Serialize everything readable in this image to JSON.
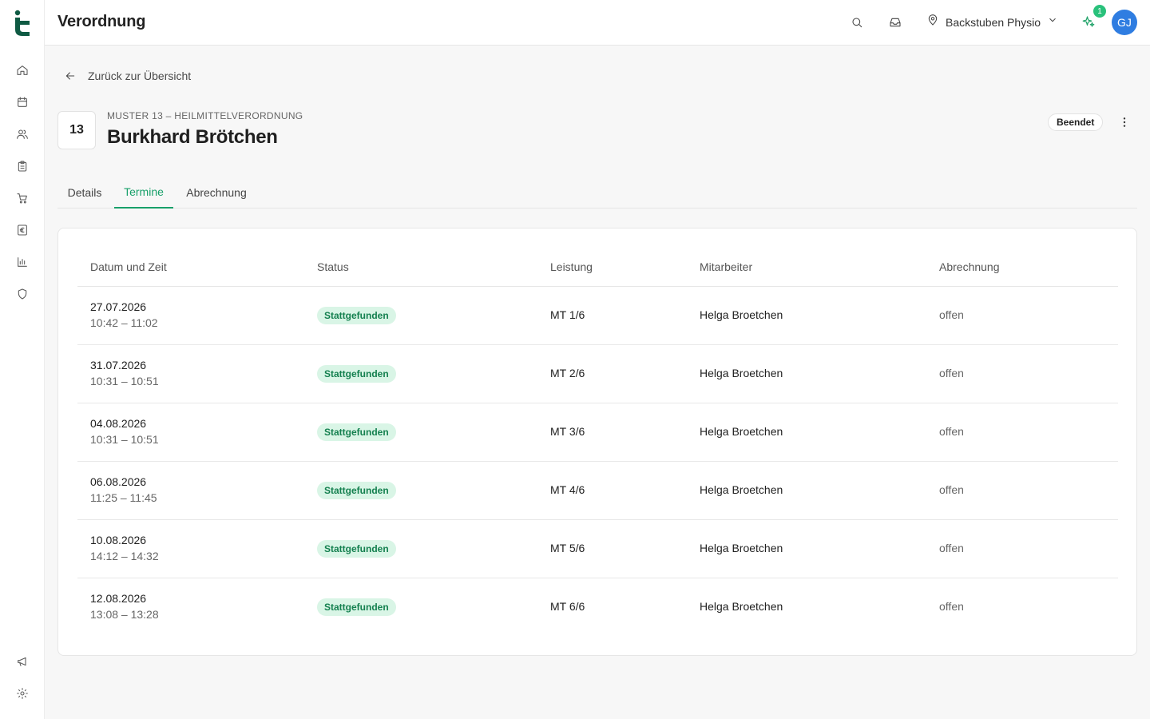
{
  "header": {
    "title": "Verordnung",
    "location": "Backstuben Physio",
    "notifications": "1",
    "avatar": "GJ"
  },
  "sidebar": {
    "items": [
      {
        "icon": "home-icon"
      },
      {
        "icon": "calendar-icon"
      },
      {
        "icon": "users-icon"
      },
      {
        "icon": "clipboard-icon"
      },
      {
        "icon": "cart-icon"
      },
      {
        "icon": "euro-icon"
      },
      {
        "icon": "chart-icon"
      },
      {
        "icon": "shield-icon"
      }
    ],
    "bottom": [
      {
        "icon": "megaphone-icon"
      },
      {
        "icon": "gear-icon"
      }
    ]
  },
  "back_link": "Zurück zur Übersicht",
  "prescription": {
    "number": "13",
    "type": "MUSTER 13 – HEILMITTELVERORDNUNG",
    "patient": "Burkhard Brötchen",
    "status": "Beendet"
  },
  "tabs": [
    {
      "label": "Details",
      "active": false
    },
    {
      "label": "Termine",
      "active": true
    },
    {
      "label": "Abrechnung",
      "active": false
    }
  ],
  "table": {
    "columns": [
      "Datum und Zeit",
      "Status",
      "Leistung",
      "Mitarbeiter",
      "Abrechnung"
    ],
    "rows": [
      {
        "date": "27.07.2026",
        "time": "10:42 – 11:02",
        "status": "Stattgefunden",
        "service": "MT 1/6",
        "staff": "Helga Broetchen",
        "billing": "offen"
      },
      {
        "date": "31.07.2026",
        "time": "10:31 – 10:51",
        "status": "Stattgefunden",
        "service": "MT 2/6",
        "staff": "Helga Broetchen",
        "billing": "offen"
      },
      {
        "date": "04.08.2026",
        "time": "10:31 – 10:51",
        "status": "Stattgefunden",
        "service": "MT 3/6",
        "staff": "Helga Broetchen",
        "billing": "offen"
      },
      {
        "date": "06.08.2026",
        "time": "11:25 – 11:45",
        "status": "Stattgefunden",
        "service": "MT 4/6",
        "staff": "Helga Broetchen",
        "billing": "offen"
      },
      {
        "date": "10.08.2026",
        "time": "14:12 – 14:32",
        "status": "Stattgefunden",
        "service": "MT 5/6",
        "staff": "Helga Broetchen",
        "billing": "offen"
      },
      {
        "date": "12.08.2026",
        "time": "13:08 – 13:28",
        "status": "Stattgefunden",
        "service": "MT 6/6",
        "staff": "Helga Broetchen",
        "billing": "offen"
      }
    ]
  },
  "colors": {
    "brand": "#0f5a43",
    "accent": "#18a06a",
    "badge_bg": "#d9f5e6",
    "badge_text": "#14804f",
    "avatar": "#2f7de1"
  }
}
